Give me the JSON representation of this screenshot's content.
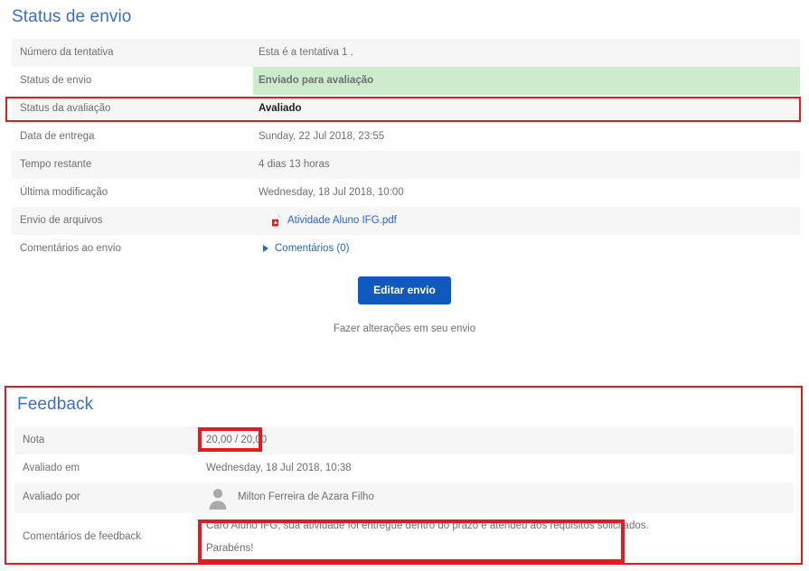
{
  "submission": {
    "heading": "Status de envio",
    "rows": [
      {
        "label": "Número da tentativa",
        "value": "Esta é a tentativa 1 ."
      },
      {
        "label": "Status de envio",
        "value": "Enviado para avaliação"
      },
      {
        "label": "Status da avaliação",
        "value": "Avaliado"
      },
      {
        "label": "Data de entrega",
        "value": "Sunday, 22 Jul 2018, 23:55"
      },
      {
        "label": "Tempo restante",
        "value": "4 dias 13 horas"
      },
      {
        "label": "Última modificação",
        "value": "Wednesday, 18 Jul 2018, 10:00"
      },
      {
        "label": "Envio de arquivos",
        "value": "Atividade Aluno IFG.pdf"
      },
      {
        "label": "Comentários ao envio",
        "value": "Comentários (0)"
      }
    ],
    "file_icon": "pdf-file-icon",
    "comments_toggle_icon": "triangle-right-icon"
  },
  "actions": {
    "edit_submission_label": "Editar envio",
    "edit_submission_hint": "Fazer alterações em seu envio"
  },
  "feedback": {
    "heading": "Feedback",
    "rows": [
      {
        "label": "Nota",
        "value": "20,00 / 20,00"
      },
      {
        "label": "Avaliado em",
        "value": "Wednesday, 18 Jul 2018, 10:38"
      },
      {
        "label": "Avaliado por",
        "value": "Milton Ferreira de Azara Filho"
      },
      {
        "label": "Comentários de feedback",
        "value": ""
      }
    ],
    "comment_line_1": "Caro Aluno IFG, sua atividade foi entregue dentro do prazo e atendeu aos requisitos solicitados.",
    "comment_line_2": "Parabéns!",
    "grader_avatar_icon": "user-avatar-icon"
  },
  "colors": {
    "heading_blue": "#3b6ec6",
    "link_blue": "#2a64c8",
    "button_blue": "#1259bd",
    "highlight_red": "#e01b22",
    "success_green_bg": "#cdebcd",
    "row_alt_bg": "#f6f6f6",
    "text_gray": "#6f6f6f"
  }
}
